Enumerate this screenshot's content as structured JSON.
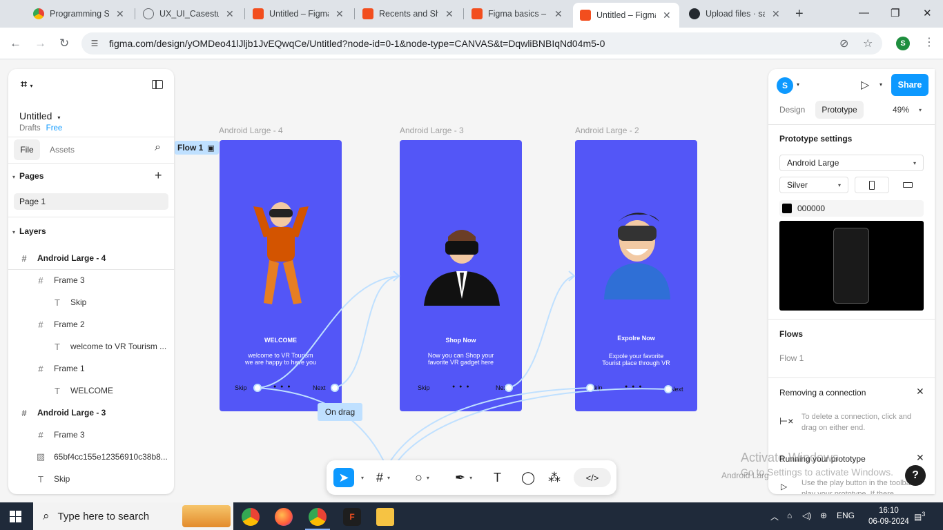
{
  "browser": {
    "tabs": [
      {
        "label": "Programming Sk",
        "icon": "chrome-icon"
      },
      {
        "label": "UX_UI_Casestud",
        "icon": "globe-icon"
      },
      {
        "label": "Untitled – Figma",
        "icon": "figma-icon"
      },
      {
        "label": "Recents and Sha",
        "icon": "figma-icon"
      },
      {
        "label": "Figma basics – F",
        "icon": "figma-icon"
      },
      {
        "label": "Untitled – Figma",
        "icon": "figma-icon",
        "active": true
      },
      {
        "label": "Upload files · sar",
        "icon": "github-icon"
      }
    ],
    "url": "figma.com/design/yOMDeo41lJljb1JvEQwqCe/Untitled?node-id=0-1&node-type=CANVAS&t=DqwliBNBIqNd04m5-0",
    "profile_initial": "S"
  },
  "left_panel": {
    "file_name": "Untitled",
    "drafts": "Drafts",
    "plan": "Free",
    "tab_file": "File",
    "tab_assets": "Assets",
    "pages_header": "Pages",
    "pages": [
      "Page 1"
    ],
    "layers_header": "Layers",
    "layers": [
      {
        "name": "Android Large - 4",
        "icon": "frame",
        "indent": 0
      },
      {
        "name": "Frame 3",
        "icon": "frame",
        "indent": 1
      },
      {
        "name": "Skip",
        "icon": "text",
        "indent": 2
      },
      {
        "name": "Frame 2",
        "icon": "frame",
        "indent": 1
      },
      {
        "name": "welcome to VR Tourism ...",
        "icon": "text",
        "indent": 2
      },
      {
        "name": "Frame 1",
        "icon": "frame",
        "indent": 1
      },
      {
        "name": "WELCOME",
        "icon": "text",
        "indent": 2
      },
      {
        "name": "Android Large - 3",
        "icon": "frame",
        "indent": 0
      },
      {
        "name": "Frame 3",
        "icon": "frame",
        "indent": 1
      },
      {
        "name": "65bf4cc155e12356910c38b8...",
        "icon": "image",
        "indent": 1
      },
      {
        "name": "Skip",
        "icon": "text",
        "indent": 1
      }
    ]
  },
  "canvas": {
    "flow_tag": "Flow 1",
    "on_drag": "On drag",
    "frames": [
      {
        "label": "Android Large - 4",
        "title": "WELCOME",
        "body1": "welcome to VR Tourism",
        "body2": "we are happy to have you",
        "skip": "Skip",
        "next": "Next"
      },
      {
        "label": "Android Large - 3",
        "title": "Shop Now",
        "body1": "Now you can Shop your",
        "body2": "favorite VR gadget here",
        "skip": "Skip",
        "next": "Next"
      },
      {
        "label": "Android Large - 2",
        "title": "Expolre Now",
        "body1": "Expole your favorite",
        "body2": "Tourist place through VR",
        "skip": "Skip",
        "next": "Next"
      }
    ],
    "offscreen_label": "Android Large"
  },
  "right_panel": {
    "avatar_initial": "S",
    "share_label": "Share",
    "tab_design": "Design",
    "tab_prototype": "Prototype",
    "zoom": "49%",
    "settings_header": "Prototype settings",
    "device": "Android Large",
    "model": "Silver",
    "bg_color": "000000",
    "flows_header": "Flows",
    "flow_item": "Flow 1",
    "tip1_title": "Removing a connection",
    "tip1_text": "To delete a connection, click and drag on either end.",
    "tip2_title": "Running your prototype",
    "tip2_text": "Use the play button in the toolbar to play your prototype. If there"
  },
  "watermark": {
    "line1": "Activate Windows",
    "line2": "Go to Settings to activate Windows."
  },
  "taskbar": {
    "search_placeholder": "Type here to search",
    "language": "ENG",
    "time": "16:10",
    "date": "06-09-2024",
    "notifications": "3"
  },
  "colors": {
    "figma_blue": "#0d99ff",
    "frame_fill": "#5356f7",
    "connector": "#bfe0ff"
  }
}
